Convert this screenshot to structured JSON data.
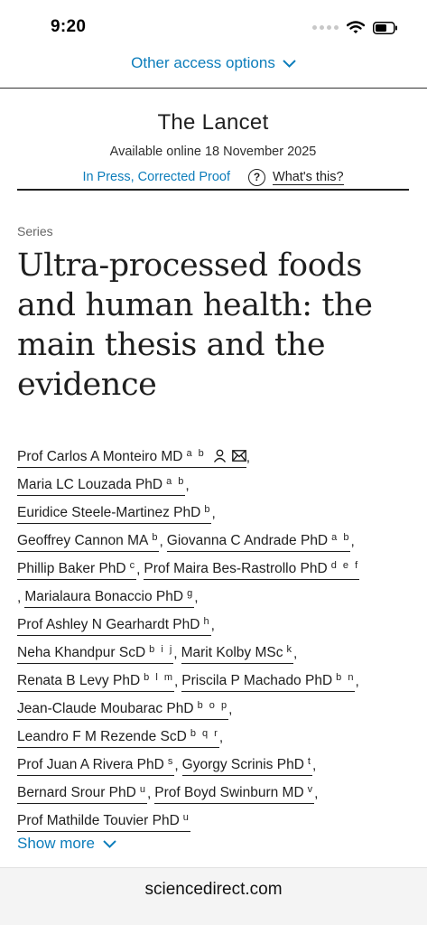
{
  "status_bar": {
    "time": "9:20"
  },
  "access": {
    "label": "Other access options"
  },
  "journal": {
    "name": "The Lancet",
    "available": "Available online 18 November 2025",
    "status": "In Press, Corrected Proof",
    "help_symbol": "?",
    "whats_this": "What's this?"
  },
  "article": {
    "series": "Series",
    "title": "Ultra-processed foods and human health: the main thesis and the evidence"
  },
  "authors": {
    "a1": {
      "name": "Prof Carlos A Monteiro MD",
      "aff": "a b"
    },
    "a2": {
      "name": "Maria LC Louzada PhD",
      "aff": "a b"
    },
    "a3": {
      "name": "Euridice Steele-Martinez PhD",
      "aff": "b"
    },
    "a4": {
      "name": "Geoffrey Cannon MA",
      "aff": "b"
    },
    "a5": {
      "name": "Giovanna C Andrade PhD",
      "aff": "a b"
    },
    "a6": {
      "name": "Phillip Baker PhD",
      "aff": "c"
    },
    "a7": {
      "name": "Prof Maira Bes-Rastrollo PhD",
      "aff": "d e f"
    },
    "a8": {
      "name": "Marialaura Bonaccio PhD",
      "aff": "g"
    },
    "a9": {
      "name": "Prof Ashley N Gearhardt PhD",
      "aff": "h"
    },
    "a10": {
      "name": "Neha Khandpur ScD",
      "aff": "b i j"
    },
    "a11": {
      "name": "Marit Kolby MSc",
      "aff": "k"
    },
    "a12": {
      "name": "Renata B Levy PhD",
      "aff": "b l m"
    },
    "a13": {
      "name": "Priscila P Machado PhD",
      "aff": "b n"
    },
    "a14": {
      "name": "Jean-Claude Moubarac PhD",
      "aff": "b o p"
    },
    "a15": {
      "name": "Leandro F M Rezende ScD",
      "aff": "b q r"
    },
    "a16": {
      "name": "Prof Juan A Rivera PhD",
      "aff": "s"
    },
    "a17": {
      "name": "Gyorgy Scrinis PhD",
      "aff": "t"
    },
    "a18": {
      "name": "Bernard Srour PhD",
      "aff": "u"
    },
    "a19": {
      "name": "Prof Boyd Swinburn MD",
      "aff": "v"
    },
    "a20": {
      "name": "Prof Mathilde Touvier PhD",
      "aff": "u"
    }
  },
  "show_more": {
    "label": "Show more"
  },
  "footer": {
    "domain": "sciencedirect.com"
  },
  "colors": {
    "link": "#0c7dbb",
    "text": "#1f1f1f",
    "footer_bg": "#f4f4f4"
  },
  "icons": [
    "cellular-signal-icon",
    "wifi-icon",
    "battery-icon",
    "chevron-down-icon",
    "help-circle-icon",
    "person-icon",
    "envelope-icon"
  ]
}
